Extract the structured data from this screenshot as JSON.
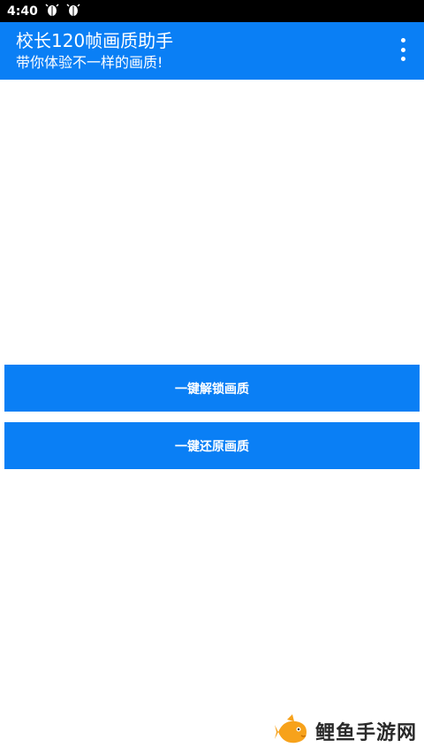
{
  "status_bar": {
    "time": "4:40",
    "icons": [
      "bug-icon",
      "bug-icon"
    ]
  },
  "app_bar": {
    "title": "校长120帧画质助手",
    "subtitle": "带你体验不一样的画质!",
    "menu_icon": "overflow-menu-icon"
  },
  "actions": {
    "unlock_label": "一键解锁画质",
    "restore_label": "一键还原画质"
  },
  "watermark": {
    "text": "鲤鱼手游网",
    "icon": "fish-logo"
  },
  "colors": {
    "accent": "#0a7ff5",
    "status_bar": "#000000",
    "background": "#ffffff"
  }
}
